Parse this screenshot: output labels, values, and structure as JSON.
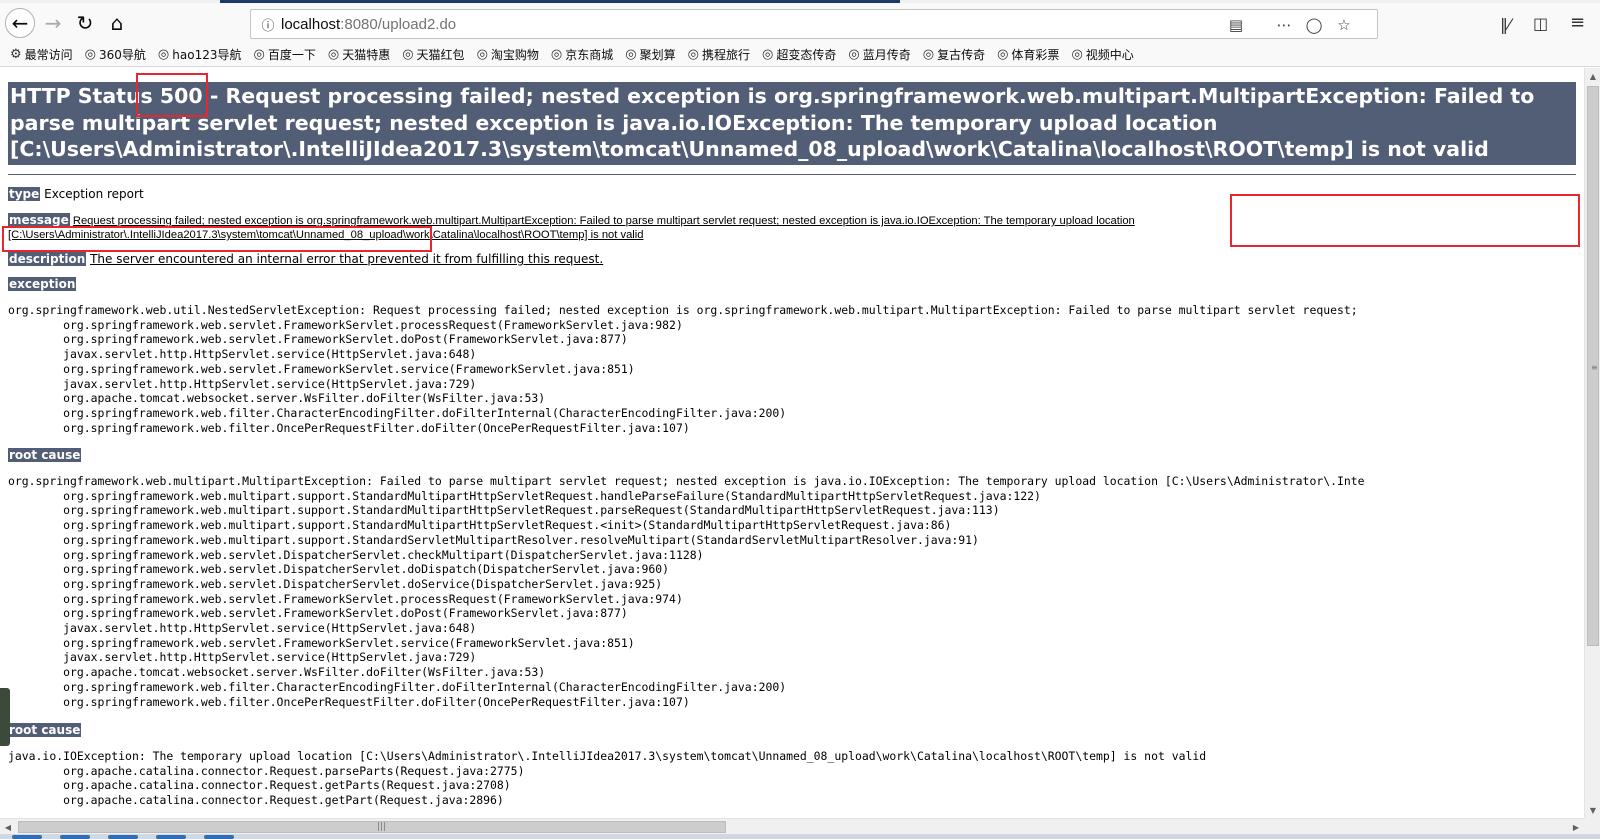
{
  "browser": {
    "url_host": "localhost",
    "url_path": ":8080/upload2.do",
    "bookmarks": [
      {
        "label": "最常访问",
        "icon": "gear-icon"
      },
      {
        "label": "360导航",
        "icon": "globe-icon"
      },
      {
        "label": "hao123导航",
        "icon": "globe-icon"
      },
      {
        "label": "百度一下",
        "icon": "globe-icon"
      },
      {
        "label": "天猫特惠",
        "icon": "globe-icon"
      },
      {
        "label": "天猫红包",
        "icon": "globe-icon"
      },
      {
        "label": "淘宝购物",
        "icon": "globe-icon"
      },
      {
        "label": "京东商城",
        "icon": "globe-icon"
      },
      {
        "label": "聚划算",
        "icon": "globe-icon"
      },
      {
        "label": "携程旅行",
        "icon": "globe-icon"
      },
      {
        "label": "超变态传奇",
        "icon": "globe-icon"
      },
      {
        "label": "蓝月传奇",
        "icon": "globe-icon"
      },
      {
        "label": "复古传奇",
        "icon": "globe-icon"
      },
      {
        "label": "体育彩票",
        "icon": "globe-icon"
      },
      {
        "label": "视频中心",
        "icon": "globe-icon"
      }
    ]
  },
  "page": {
    "heading": "HTTP Status 500 - Request processing failed; nested exception is org.springframework.web.multipart.MultipartException: Failed to parse multipart servlet request; nested exception is java.io.IOException: The temporary upload location [C:\\Users\\Administrator\\.IntelliJIdea2017.3\\system\\tomcat\\Unnamed_08_upload\\work\\Catalina\\localhost\\ROOT\\temp] is not valid",
    "type_label": "type",
    "type_value": "Exception report",
    "message_label": "message",
    "message_value_plain": "Request processing failed; nested exception is org.springframework.web.multipart.MultipartException: Failed to parse multipart servlet request; nested exception is java.io.IOException: The temporary upload location ",
    "message_value_underlined": "[C:\\Users\\Administrator\\.IntelliJIdea2017.3\\system\\tomcat\\Unnamed_08_upload\\work\\Catalina\\localhost\\ROOT\\temp] is not valid",
    "description_label": "description",
    "description_value": "The server encountered an internal error that prevented it from fulfilling this request.",
    "exception_label": "exception",
    "exception_trace": "org.springframework.web.util.NestedServletException: Request processing failed; nested exception is org.springframework.web.multipart.MultipartException: Failed to parse multipart servlet request;\n\torg.springframework.web.servlet.FrameworkServlet.processRequest(FrameworkServlet.java:982)\n\torg.springframework.web.servlet.FrameworkServlet.doPost(FrameworkServlet.java:877)\n\tjavax.servlet.http.HttpServlet.service(HttpServlet.java:648)\n\torg.springframework.web.servlet.FrameworkServlet.service(FrameworkServlet.java:851)\n\tjavax.servlet.http.HttpServlet.service(HttpServlet.java:729)\n\torg.apache.tomcat.websocket.server.WsFilter.doFilter(WsFilter.java:53)\n\torg.springframework.web.filter.CharacterEncodingFilter.doFilterInternal(CharacterEncodingFilter.java:200)\n\torg.springframework.web.filter.OncePerRequestFilter.doFilter(OncePerRequestFilter.java:107)",
    "root_cause_label_1": "root cause",
    "root_cause_trace_1": "org.springframework.web.multipart.MultipartException: Failed to parse multipart servlet request; nested exception is java.io.IOException: The temporary upload location [C:\\Users\\Administrator\\.Inte\n\torg.springframework.web.multipart.support.StandardMultipartHttpServletRequest.handleParseFailure(StandardMultipartHttpServletRequest.java:122)\n\torg.springframework.web.multipart.support.StandardMultipartHttpServletRequest.parseRequest(StandardMultipartHttpServletRequest.java:113)\n\torg.springframework.web.multipart.support.StandardMultipartHttpServletRequest.<init>(StandardMultipartHttpServletRequest.java:86)\n\torg.springframework.web.multipart.support.StandardServletMultipartResolver.resolveMultipart(StandardServletMultipartResolver.java:91)\n\torg.springframework.web.servlet.DispatcherServlet.checkMultipart(DispatcherServlet.java:1128)\n\torg.springframework.web.servlet.DispatcherServlet.doDispatch(DispatcherServlet.java:960)\n\torg.springframework.web.servlet.DispatcherServlet.doService(DispatcherServlet.java:925)\n\torg.springframework.web.servlet.FrameworkServlet.processRequest(FrameworkServlet.java:974)\n\torg.springframework.web.servlet.FrameworkServlet.doPost(FrameworkServlet.java:877)\n\tjavax.servlet.http.HttpServlet.service(HttpServlet.java:648)\n\torg.springframework.web.servlet.FrameworkServlet.service(FrameworkServlet.java:851)\n\tjavax.servlet.http.HttpServlet.service(HttpServlet.java:729)\n\torg.apache.tomcat.websocket.server.WsFilter.doFilter(WsFilter.java:53)\n\torg.springframework.web.filter.CharacterEncodingFilter.doFilterInternal(CharacterEncodingFilter.java:200)\n\torg.springframework.web.filter.OncePerRequestFilter.doFilter(OncePerRequestFilter.java:107)",
    "root_cause_label_2": "root cause",
    "root_cause_trace_2": "java.io.IOException: The temporary upload location [C:\\Users\\Administrator\\.IntelliJIdea2017.3\\system\\tomcat\\Unnamed_08_upload\\work\\Catalina\\localhost\\ROOT\\temp] is not valid\n\torg.apache.catalina.connector.Request.parseParts(Request.java:2775)\n\torg.apache.catalina.connector.Request.getParts(Request.java:2708)\n\torg.apache.catalina.connector.Request.getPart(Request.java:2896)"
  },
  "colors": {
    "label_bg": "#525d76",
    "annotation_red": "#e8262f"
  }
}
